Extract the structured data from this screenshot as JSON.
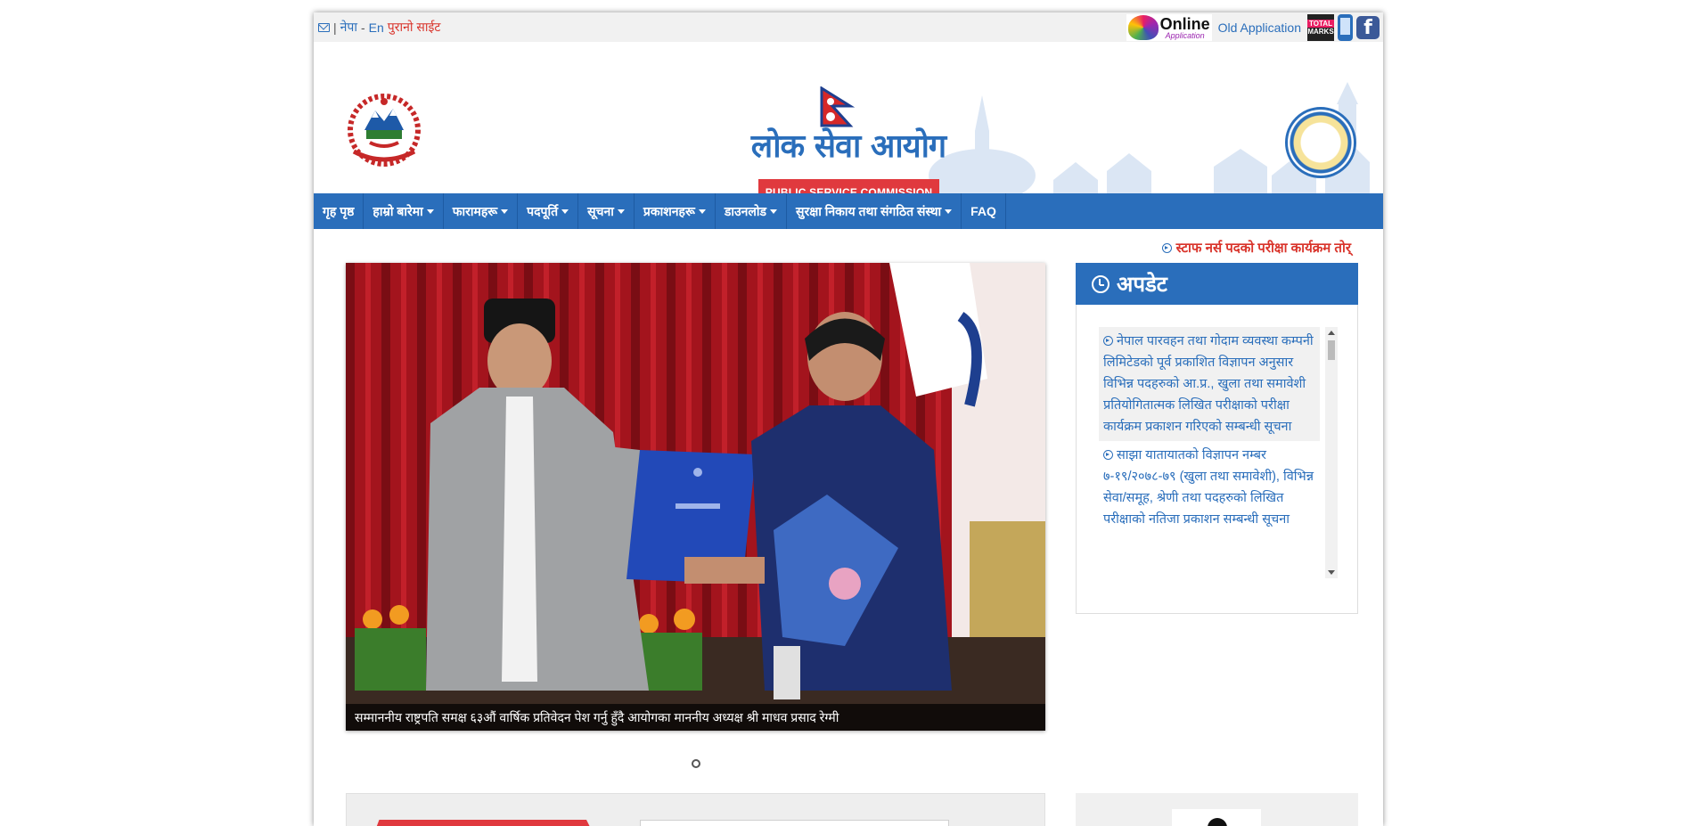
{
  "topbar": {
    "lang_ne": "नेपा",
    "lang_sep": "-",
    "lang_en": "En",
    "old_site": "पुरानो साईट",
    "online_text": "Online",
    "online_sub": "Application",
    "old_application": "Old Application",
    "marks_top": "TOTAL",
    "marks_bottom": "MARKS",
    "facebook_letter": "f"
  },
  "header": {
    "title": "लोक सेवा आयोग",
    "subtitle": "PUBLIC SERVICE COMMISSION"
  },
  "nav": {
    "items": [
      {
        "label": "गृह पृष्ठ",
        "dropdown": false
      },
      {
        "label": "हाम्रो बारेमा",
        "dropdown": true
      },
      {
        "label": "फारामहरू",
        "dropdown": true
      },
      {
        "label": "पदपूर्ति",
        "dropdown": true
      },
      {
        "label": "सूचना",
        "dropdown": true
      },
      {
        "label": "प्रकाशनहरू",
        "dropdown": true
      },
      {
        "label": "डाउनलोड",
        "dropdown": true
      },
      {
        "label": "सुरक्षा निकाय तथा संगठित संस्था",
        "dropdown": true
      },
      {
        "label": "FAQ",
        "dropdown": false
      }
    ]
  },
  "ticker": {
    "text": "स्टाफ नर्स पदको परीक्षा कार्यक्रम तोर्"
  },
  "slider": {
    "caption": "सम्माननीय राष्ट्रपति समक्ष ६३औं वार्षिक प्रतिवेदन पेश गर्नु हुँदै आयोगका माननीय अध्यक्ष श्री माधव प्रसाद रेग्मी"
  },
  "updates": {
    "heading": "अपडेट",
    "items": [
      {
        "text": "नेपाल पारवहन तथा गोदाम व्यवस्था कम्पनी लिमिटेडको पूर्व प्रकाशित विज्ञापन अनुसार विभिन्न पदहरुको आ.प्र., खुला तथा समावेशी प्रतियोगितात्मक लिखित परीक्षाको परीक्षा कार्यक्रम प्रकाशन गरिएको सम्बन्धी सूचना"
      },
      {
        "text": "साझा यातायातको विज्ञापन नम्बर ७-१९/२०७८-७९ (खुला तथा समावेशी), विभिन्न सेवा/समूह, श्रेणी तथा पदहरुको लिखित परीक्षाको नतिजा प्रकाशन सम्बन्धी सूचना"
      }
    ]
  },
  "colors": {
    "primary": "#2a6ebb",
    "accent_red": "#e0393e",
    "topbar_bg": "#f1f1f1"
  }
}
